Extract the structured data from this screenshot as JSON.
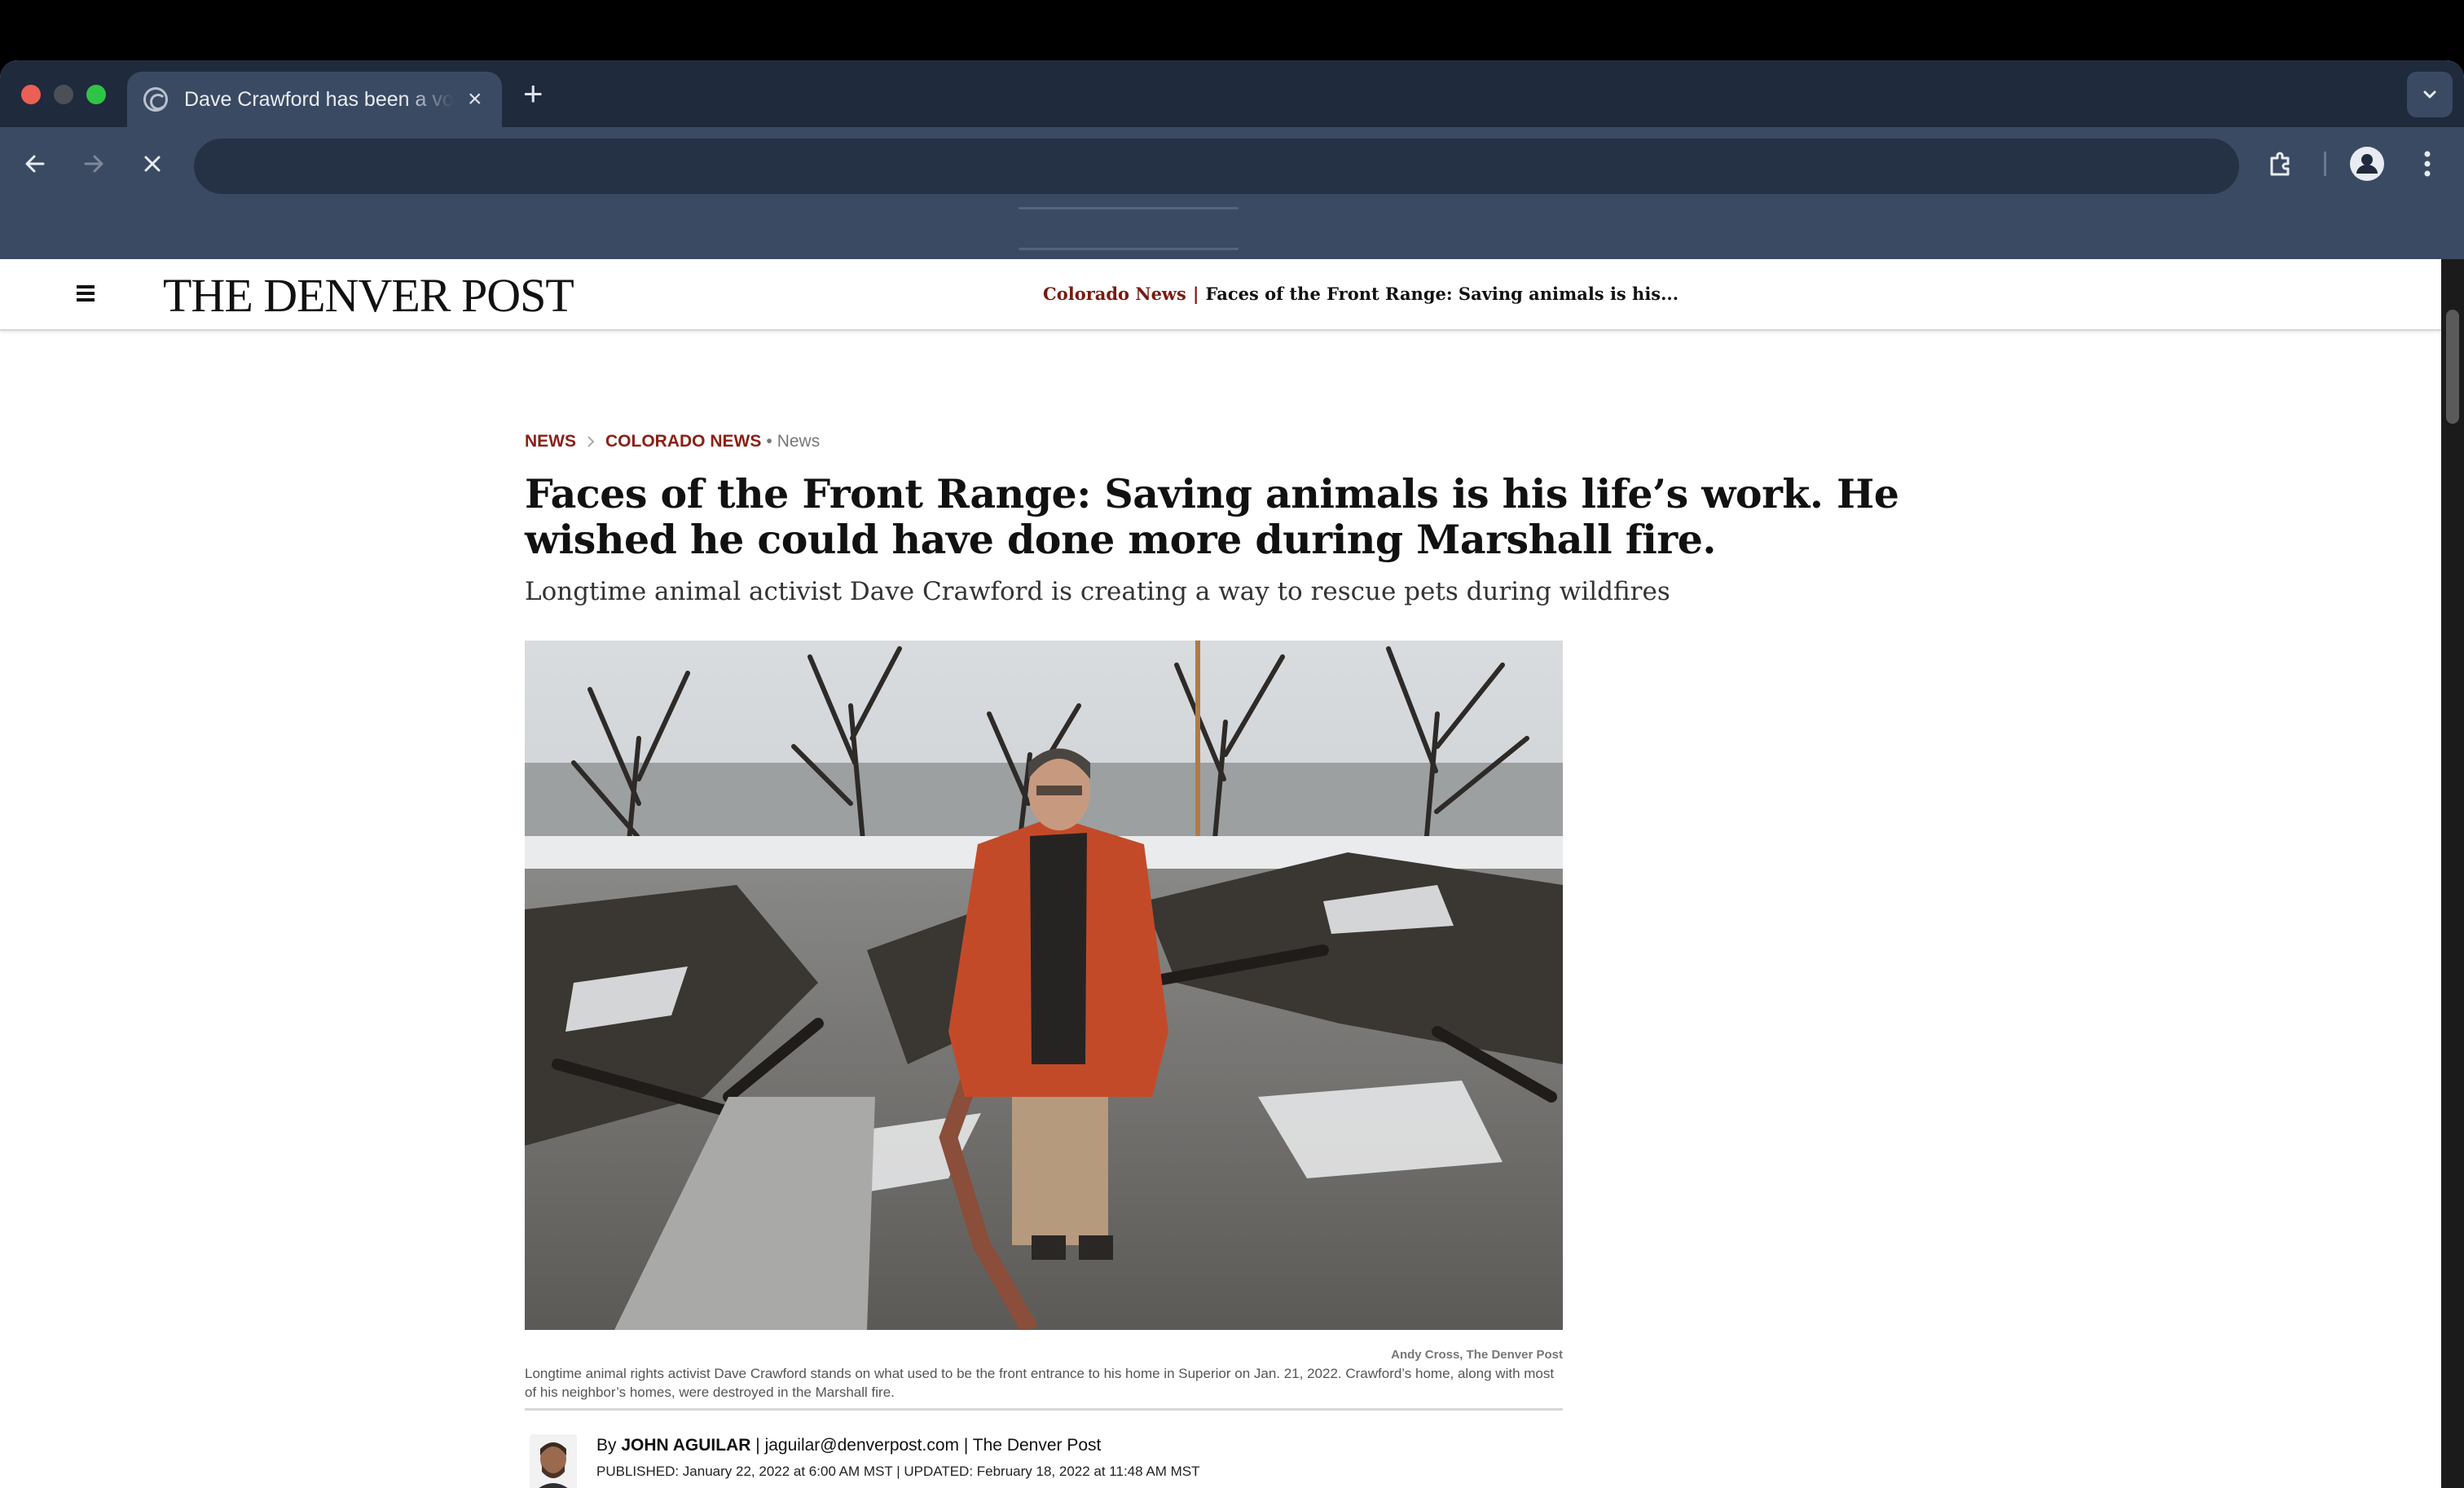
{
  "browser": {
    "tab_title": "Dave Crawford has been a vo",
    "new_tab_symbol": "+",
    "close_symbol": "×",
    "address_value": ""
  },
  "site": {
    "logo": "THE DENVER POST",
    "trail_section": "Colorado News",
    "trail_separator": "|",
    "trail_headline": "Faces of the Front Range: Saving animals is his..."
  },
  "article": {
    "crumbs": {
      "news": "NEWS",
      "colorado_news": "COLORADO NEWS",
      "dot": "•",
      "tag": "News"
    },
    "headline": "Faces of the Front Range: Saving animals is his life’s work. He wished he could have done more during Marshall fire.",
    "dek": "Longtime animal activist Dave Crawford is creating a way to rescue pets during wildfires",
    "photo_credit": "Andy Cross, The Denver Post",
    "photo_caption": "Longtime animal rights activist Dave Crawford stands on what used to be the front entrance to his home in Superior on Jan. 21, 2022. Crawford’s home, along with most of his neighbor’s homes, were destroyed in the Marshall fire.",
    "byline": {
      "by": "By",
      "author": "JOHN AGUILAR",
      "email": "jaguilar@denverpost.com",
      "outlet": "The Denver Post",
      "sep": "|",
      "dates": "PUBLISHED: January 22, 2022 at 6:00 AM MST | UPDATED: February 18, 2022 at 11:48 AM MST"
    }
  },
  "colors": {
    "chrome_dark": "#1f2a3c",
    "chrome_toolbar": "#3b4a63",
    "section_red": "#8b2016"
  },
  "icons": [
    "globe-icon",
    "close-icon",
    "plus-icon",
    "chevron-down-icon",
    "back-arrow-icon",
    "forward-arrow-icon",
    "stop-icon",
    "extensions-icon",
    "profile-icon",
    "kebab-menu-icon",
    "hamburger-icon"
  ]
}
